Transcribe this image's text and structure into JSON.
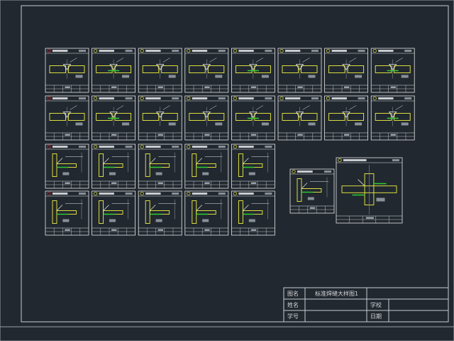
{
  "title_block": {
    "label_drawing_name": "图名",
    "drawing_name": "标准焊缝大样图1",
    "label_name": "姓名",
    "label_school": "学校",
    "label_student_id": "学号",
    "label_date": "日期"
  },
  "colors": {
    "background": "#212830",
    "line": "#e8e8e8",
    "frame": "#9aa0a8",
    "yellow": "#f0f040",
    "green": "#30d030",
    "red": "#e03030"
  },
  "details": {
    "rows": [
      {
        "count": 8,
        "type": "butt"
      },
      {
        "count": 8,
        "type": "butt"
      },
      {
        "count": 5,
        "type": "tee"
      },
      {
        "count": 5,
        "type": "tee"
      }
    ],
    "large": [
      {
        "type": "tee"
      },
      {
        "type": "cross"
      }
    ]
  }
}
